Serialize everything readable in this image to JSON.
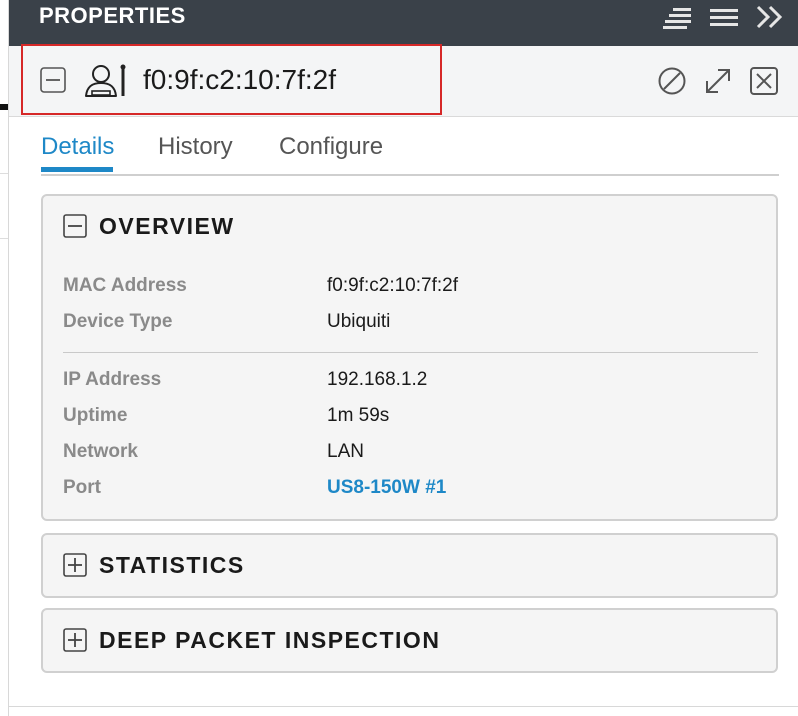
{
  "header": {
    "title": "PROPERTIES",
    "icons": [
      "align-icon",
      "menu-icon",
      "double-chevron-right-icon"
    ]
  },
  "device": {
    "name": "f0:9f:c2:10:7f:2f",
    "icon": "device-user-icon",
    "actions": [
      "block-icon",
      "expand-icon",
      "close-icon"
    ]
  },
  "tabs": [
    {
      "label": "Details",
      "active": true
    },
    {
      "label": "History",
      "active": false
    },
    {
      "label": "Configure",
      "active": false
    }
  ],
  "overview": {
    "title": "OVERVIEW",
    "expanded": true,
    "rows": [
      {
        "label": "MAC Address",
        "value": "f0:9f:c2:10:7f:2f"
      },
      {
        "label": "Device Type",
        "value": "Ubiquiti"
      },
      {
        "label": "IP Address",
        "value": "192.168.1.2"
      },
      {
        "label": "Uptime",
        "value": "1m 59s"
      },
      {
        "label": "Network",
        "value": "LAN"
      },
      {
        "label": "Port",
        "value": "US8-150W #1",
        "link": true
      }
    ]
  },
  "statistics": {
    "title": "STATISTICS",
    "expanded": false
  },
  "dpi": {
    "title": "DEEP PACKET INSPECTION",
    "expanded": false
  },
  "colors": {
    "topbar_bg": "#3a4149",
    "accent": "#1e88c7",
    "highlight": "#d62828",
    "section_bg": "#f5f5f5"
  }
}
